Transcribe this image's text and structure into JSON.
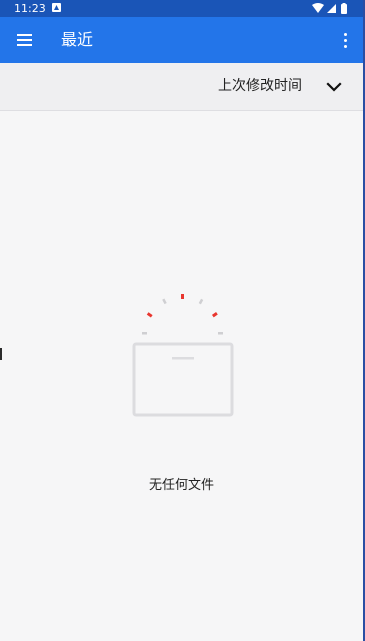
{
  "status_bar": {
    "time": "11:23",
    "icons": [
      "notification-a-icon",
      "wifi-icon",
      "signal-icon",
      "battery-icon"
    ]
  },
  "app_bar": {
    "title": "最近",
    "menu_icon": "hamburger-menu-icon",
    "more_icon": "more-vert-icon"
  },
  "sort_bar": {
    "label": "上次修改时间",
    "icon": "chevron-down-icon"
  },
  "empty_state": {
    "message": "无任何文件",
    "illustration": "empty-box-icon"
  },
  "colors": {
    "status_bar": "#1a55b7",
    "app_bar": "#2375e9",
    "background": "#f6f6f7",
    "sort_bar": "#efeff1",
    "accent_red": "#e8362f"
  }
}
